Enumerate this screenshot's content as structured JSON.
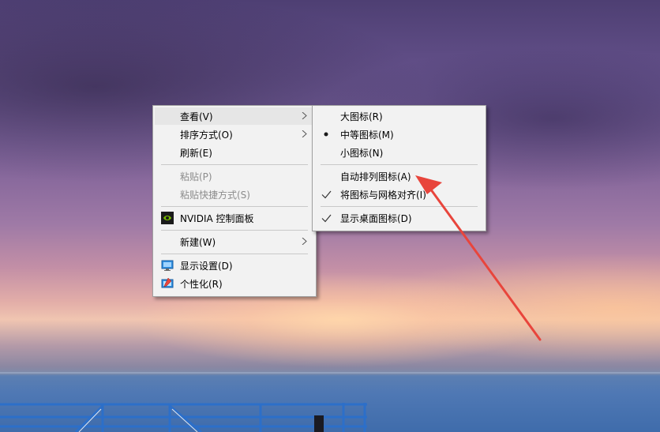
{
  "desktop": {
    "wallpaper": "purple sky over sea with pier railing"
  },
  "context_menu": {
    "items": [
      {
        "label": "查看(V)",
        "has_submenu": true,
        "highlighted": true,
        "disabled": false
      },
      {
        "label": "排序方式(O)",
        "has_submenu": true,
        "highlighted": false,
        "disabled": false
      },
      {
        "label": "刷新(E)",
        "has_submenu": false,
        "highlighted": false,
        "disabled": false
      },
      {
        "label": "粘贴(P)",
        "has_submenu": false,
        "highlighted": false,
        "disabled": true
      },
      {
        "label": "粘贴快捷方式(S)",
        "has_submenu": false,
        "highlighted": false,
        "disabled": true
      },
      {
        "label": "NVIDIA 控制面板",
        "icon": "nvidia-icon",
        "has_submenu": false,
        "highlighted": false,
        "disabled": false
      },
      {
        "label": "新建(W)",
        "has_submenu": true,
        "highlighted": false,
        "disabled": false
      },
      {
        "label": "显示设置(D)",
        "icon": "display-settings-icon",
        "has_submenu": false,
        "highlighted": false,
        "disabled": false
      },
      {
        "label": "个性化(R)",
        "icon": "personalize-icon",
        "has_submenu": false,
        "highlighted": false,
        "disabled": false
      }
    ]
  },
  "view_submenu": {
    "items": [
      {
        "label": "大图标(R)",
        "mark": "none"
      },
      {
        "label": "中等图标(M)",
        "mark": "bullet"
      },
      {
        "label": "小图标(N)",
        "mark": "none"
      },
      {
        "label": "自动排列图标(A)",
        "mark": "none"
      },
      {
        "label": "将图标与网格对齐(I)",
        "mark": "check"
      },
      {
        "label": "显示桌面图标(D)",
        "mark": "check"
      }
    ]
  },
  "colors": {
    "menu_bg": "#f2f2f2",
    "highlight_bg": "#e6e6e6",
    "disabled_text": "#8c8c8c",
    "annotation_arrow": "#e8453c"
  }
}
